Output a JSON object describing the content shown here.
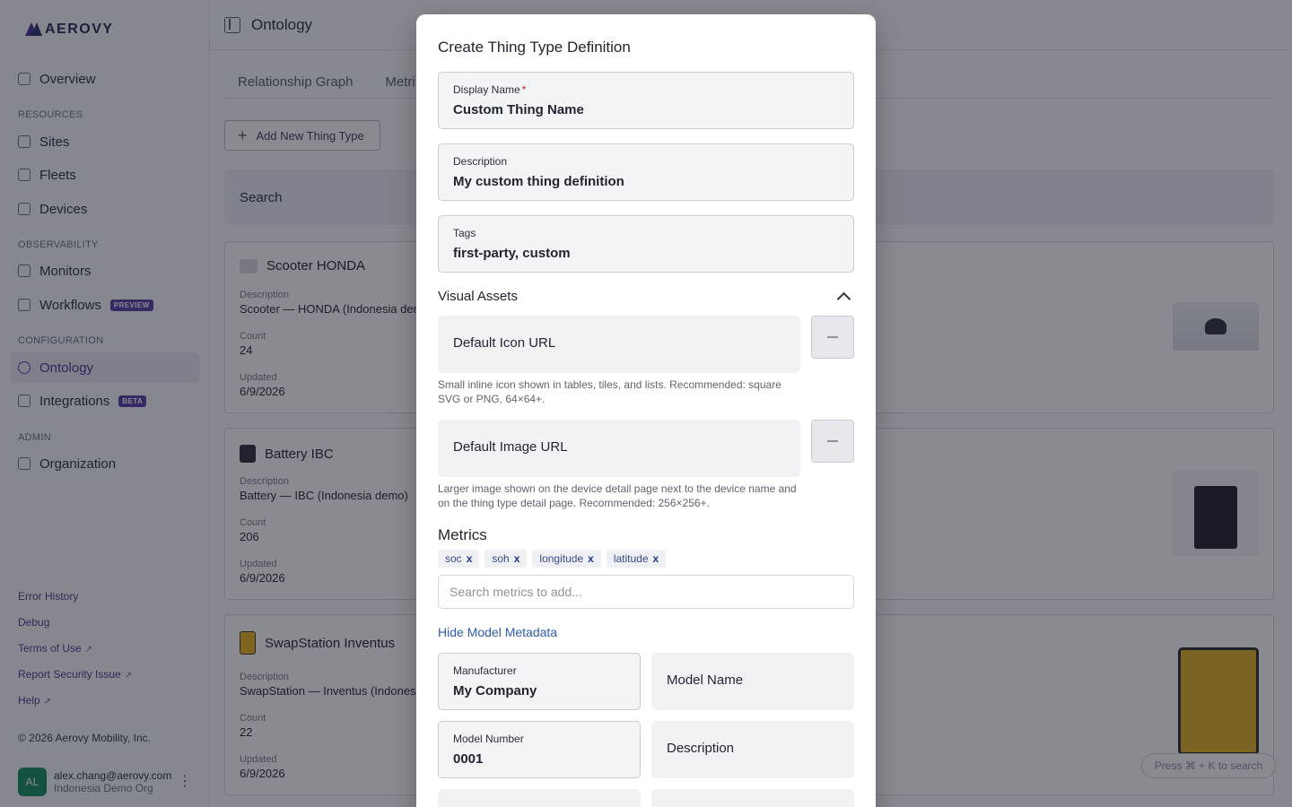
{
  "brand": {
    "name": "AEROVY"
  },
  "sidebar": {
    "overview": "Overview",
    "sections": {
      "resources": "RESOURCES",
      "observability": "OBSERVABILITY",
      "configuration": "CONFIGURATION",
      "admin": "ADMIN"
    },
    "items": {
      "sites": "Sites",
      "fleets": "Fleets",
      "devices": "Devices",
      "monitors": "Monitors",
      "workflows": "Workflows",
      "workflows_badge": "PREVIEW",
      "ontology": "Ontology",
      "integrations": "Integrations",
      "integrations_badge": "BETA",
      "organization": "Organization"
    },
    "footer": {
      "error_history": "Error History",
      "debug": "Debug",
      "terms": "Terms of Use",
      "report": "Report Security Issue",
      "help": "Help",
      "ext_glyph": "↗"
    },
    "copyright": "© 2026 Aerovy Mobility, Inc.",
    "user": {
      "initials": "AL",
      "email": "alex.chang@aerovy.com",
      "org": "Indonesia Demo Org"
    }
  },
  "topbar": {
    "title": "Ontology"
  },
  "tabs": {
    "relationship": "Relationship Graph",
    "metrics": "Metri"
  },
  "add_button": "Add New Thing Type",
  "search_label": "Search",
  "cards": [
    {
      "title": "Scooter HONDA",
      "desc_label": "Description",
      "desc": "Scooter — HONDA (Indonesia dem",
      "count_label": "Count",
      "count": "24",
      "updated_label": "Updated",
      "updated": "6/9/2026"
    },
    {
      "title": "Battery IBC",
      "desc_label": "Description",
      "desc": "Battery — IBC (Indonesia demo)",
      "count_label": "Count",
      "count": "206",
      "updated_label": "Updated",
      "updated": "6/9/2026"
    },
    {
      "title": "SwapStation Inventus",
      "desc_label": "Description",
      "desc": "SwapStation — Inventus (Indonesia",
      "count_label": "Count",
      "count": "22",
      "updated_label": "Updated",
      "updated": "6/9/2026"
    }
  ],
  "kbd_hint": "Press ⌘ + K to search",
  "modal": {
    "title": "Create Thing Type Definition",
    "display_name": {
      "label": "Display Name",
      "required": "*",
      "value": "Custom Thing Name"
    },
    "description": {
      "label": "Description",
      "value": "My custom thing definition"
    },
    "tags": {
      "label": "Tags",
      "value": "first-party, custom"
    },
    "visual_assets": "Visual Assets",
    "icon_url": {
      "placeholder": "Default Icon URL",
      "help": "Small inline icon shown in tables, tiles, and lists. Recommended: square SVG or PNG, 64×64+."
    },
    "image_url": {
      "placeholder": "Default Image URL",
      "help": "Larger image shown on the device detail page next to the device name and on the thing type detail page. Recommended: 256×256+."
    },
    "metrics": {
      "title": "Metrics",
      "chips": [
        "soc",
        "soh",
        "longitude",
        "latitude"
      ],
      "chip_x": "x",
      "search_placeholder": "Search metrics to add..."
    },
    "hide_metadata": "Hide Model Metadata",
    "manufacturer": {
      "label": "Manufacturer",
      "value": "My Company"
    },
    "model_name": {
      "placeholder": "Model Name"
    },
    "model_number": {
      "label": "Model Number",
      "value": "0001"
    },
    "model_description": {
      "placeholder": "Description"
    }
  }
}
